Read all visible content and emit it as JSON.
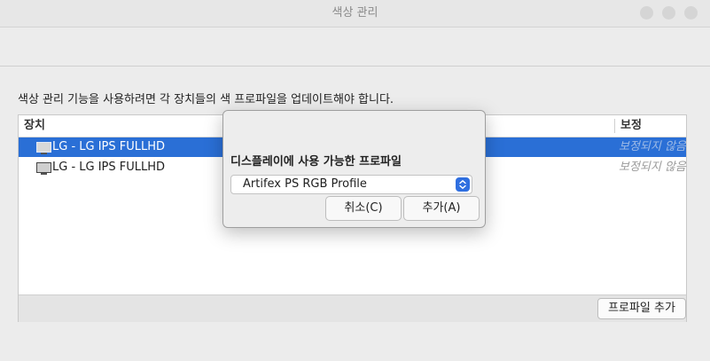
{
  "window": {
    "title": "색상 관리"
  },
  "main": {
    "description": "색상 관리 기능을 사용하려면 각 장치들의 색 프로파일을 업데이트해야 합니다.",
    "columns": {
      "device": "장치",
      "correction": "보정"
    },
    "rows": [
      {
        "device": "LG - LG IPS FULLHD",
        "correction": "보정되지 않음",
        "selected": true,
        "icon": "monitor-icon"
      },
      {
        "device": "LG - LG IPS FULLHD",
        "correction": "보정되지 않음",
        "selected": false,
        "icon": "monitor-icon"
      }
    ],
    "add_profile_label": "프로파일 추가"
  },
  "dialog": {
    "label": "디스플레이에 사용 가능한 프로파일",
    "selected_profile": "Artifex PS RGB Profile",
    "cancel_label": "취소(C)",
    "add_label": "추가(A)"
  },
  "colors": {
    "selection": "#2a6fd6",
    "select_arrow": "#2f6fe0"
  }
}
